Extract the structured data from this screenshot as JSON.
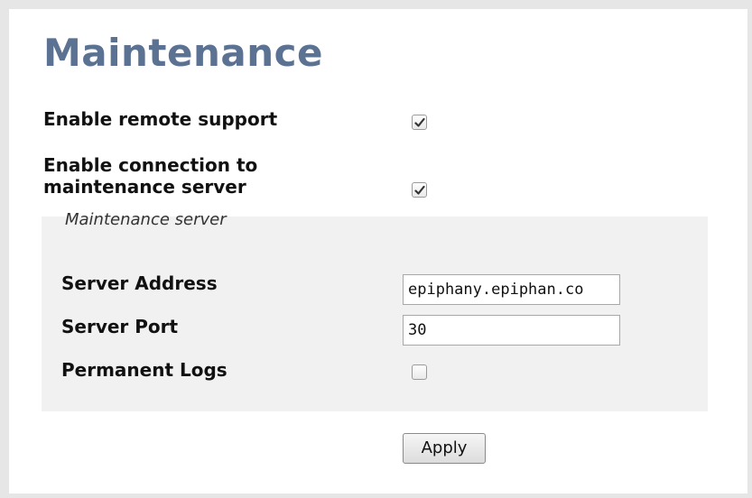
{
  "page": {
    "title": "Maintenance"
  },
  "settings": {
    "remote_support": {
      "label": "Enable remote support",
      "checked": true
    },
    "maintenance_connection": {
      "label_line1": "Enable connection to",
      "label_line2": "maintenance server",
      "checked": true
    }
  },
  "server_group": {
    "legend": "Maintenance server",
    "address": {
      "label": "Server Address",
      "value": "epiphany.epiphan.co"
    },
    "port": {
      "label": "Server Port",
      "value": "30"
    },
    "permanent_logs": {
      "label": "Permanent Logs",
      "checked": false
    }
  },
  "actions": {
    "apply_label": "Apply"
  },
  "icons": {
    "check": "checkmark-icon"
  }
}
